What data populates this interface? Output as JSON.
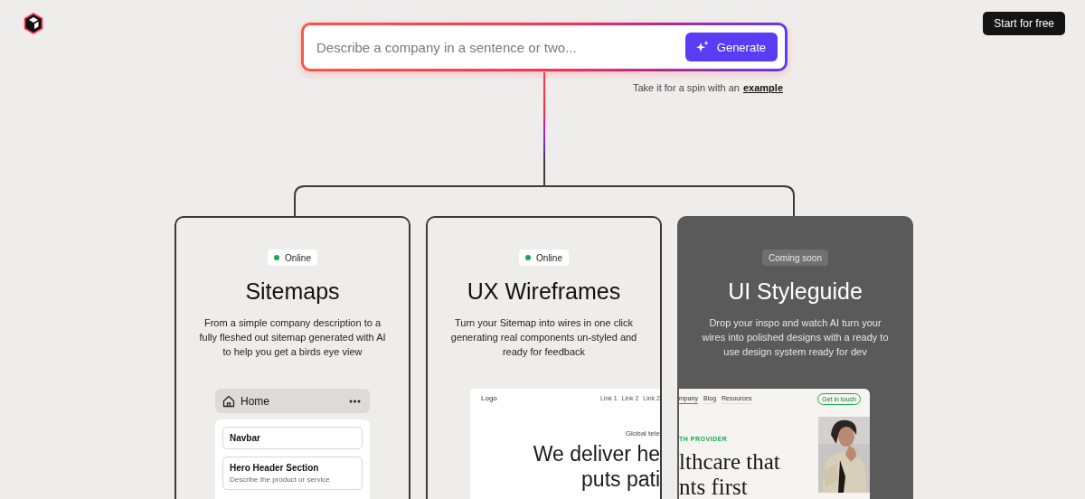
{
  "header": {
    "cta": "Start for free"
  },
  "prompt": {
    "placeholder": "Describe a company in a sentence or two...",
    "button": "Generate",
    "hint": "Take it for a spin with an",
    "hint_link": "example"
  },
  "cards": [
    {
      "kind": "sitemap",
      "status": "Online",
      "online": true,
      "title": "Sitemaps",
      "description": "From a simple company description to a fully fleshed out sitemap generated with AI to help you get a birds eye view",
      "preview": {
        "page": "Home",
        "sections": [
          {
            "title": "Navbar"
          },
          {
            "title": "Hero Header Section",
            "subtitle": "Describe the product or service"
          }
        ]
      }
    },
    {
      "kind": "wireframe",
      "status": "Online",
      "online": true,
      "title": "UX Wireframes",
      "description": "Turn your Sitemap into wires in one click generating real components un-styled and ready for feedback",
      "preview": {
        "logo": "Logo",
        "links": [
          "Link 1",
          "Link 2",
          "Link 2"
        ],
        "eyebrow": "Global tele",
        "headline": [
          "We deliver he",
          "puts pati"
        ]
      }
    },
    {
      "kind": "styleguide",
      "status": "Coming soon",
      "online": false,
      "title": "UI Styleguide",
      "description": "Drop your inspo and watch AI turn your wires into polished designs with a ready to use design system ready for dev",
      "preview": {
        "nav": [
          {
            "label": "mpany",
            "selected": true
          },
          {
            "label": "Blog",
            "selected": false
          },
          {
            "label": "Resources",
            "selected": false
          }
        ],
        "cta": "Get in touch",
        "eyebrow": "TH PROVIDER",
        "headline": [
          "lthcare that",
          "nts first"
        ],
        "image": {
          "kind": "picture"
        }
      }
    }
  ]
}
